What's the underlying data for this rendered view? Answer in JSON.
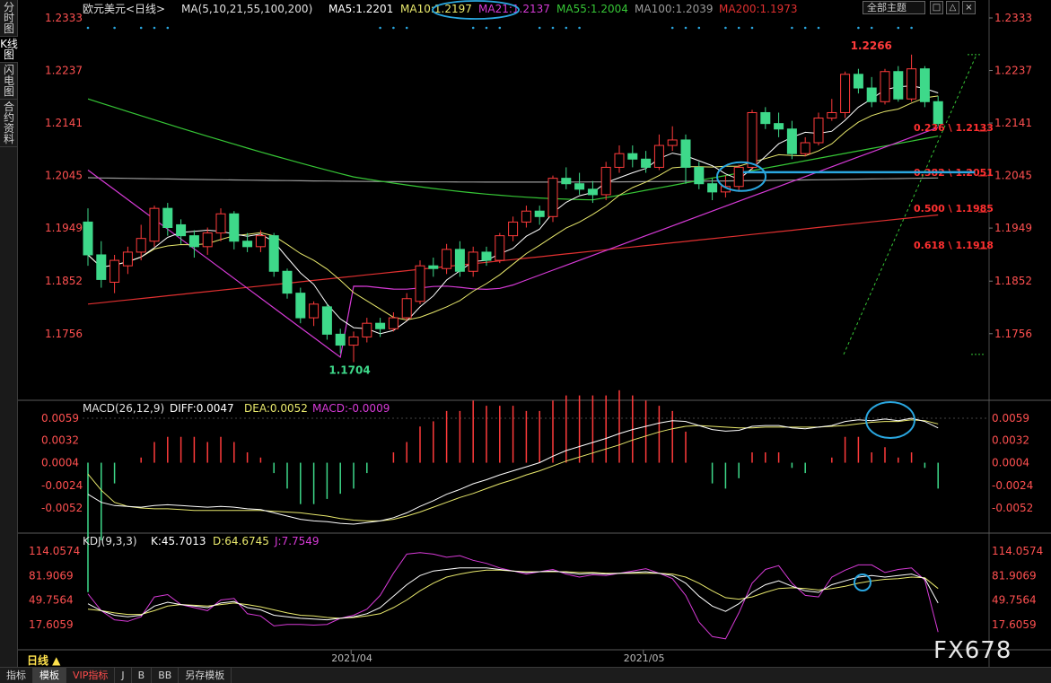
{
  "leftbar": {
    "tabs": [
      "分时图",
      "K线图",
      "闪电图",
      "合约资料"
    ],
    "active": 1
  },
  "toolbar": {
    "all_label": "全部主题",
    "buttons": [
      "□",
      "△",
      "×"
    ]
  },
  "bottombar": {
    "tabs": [
      "指标",
      "模板",
      "VIP指标",
      "J",
      "B",
      "BB",
      "另存模板"
    ],
    "active": 1,
    "vip_color": "#ff4c4c"
  },
  "period_label": "日线 ▲",
  "watermark": "FX678",
  "colors": {
    "up": "#ff3b3b",
    "down": "#3ed98a",
    "ma5": "#ffffff",
    "ma10": "#e8e86c",
    "ma21": "#d63ad6",
    "ma55": "#36c636",
    "ma100": "#9a9a9a",
    "ma200": "#e03030",
    "fib": "#ff3030",
    "annot": "#2aa7e0",
    "grid": "#303030",
    "axis_text": "#ff5050"
  },
  "chart_data": [
    {
      "type": "candlestick",
      "title": "欧元美元<日线>",
      "legend": [
        {
          "text": "MA(5,10,21,55,100,200)",
          "color": "#e0e0e0"
        },
        {
          "text": "MA5:1.2201",
          "color": "#ffffff"
        },
        {
          "text": "MA10:1.2197",
          "color": "#e8e86c"
        },
        {
          "text": "MA21:1.2137",
          "color": "#d63ad6"
        },
        {
          "text": "MA55:1.2004",
          "color": "#36c636"
        },
        {
          "text": "MA100:1.2039",
          "color": "#9a9a9a"
        },
        {
          "text": "MA200:1.1973",
          "color": "#e03030"
        }
      ],
      "y_ticks": [
        "1.2333",
        "1.2237",
        "1.2141",
        "1.2045",
        "1.1949",
        "1.1852",
        "1.1756"
      ],
      "ylim": [
        1.169,
        1.2333
      ],
      "x_ticks": [
        {
          "label": "2021/04",
          "index": 19
        },
        {
          "label": "2021/05",
          "index": 41
        }
      ],
      "annotations": [
        {
          "text": "1.2266",
          "index": 57,
          "value": 1.2266,
          "color": "#ff3b3b"
        },
        {
          "text": "1.1704",
          "index": 18,
          "value": 1.1704,
          "color": "#3ed98a"
        }
      ],
      "fib_levels": [
        {
          "text": "0.236 \\ 1.2133",
          "value": 1.2133
        },
        {
          "text": "0.382 \\ 1.2051",
          "value": 1.2051
        },
        {
          "text": "0.500 \\ 1.1985",
          "value": 1.1985
        },
        {
          "text": "0.618 \\ 1.1918",
          "value": 1.1918
        }
      ],
      "candles": [
        [
          1.196,
          1.19,
          1.1985,
          1.188
        ],
        [
          1.19,
          1.1855,
          1.1925,
          1.184
        ],
        [
          1.185,
          1.189,
          1.19,
          1.183
        ],
        [
          1.188,
          1.1905,
          1.1915,
          1.1865
        ],
        [
          1.1905,
          1.193,
          1.1955,
          1.189
        ],
        [
          1.1925,
          1.1985,
          1.199,
          1.1915
        ],
        [
          1.1985,
          1.195,
          1.1995,
          1.1935
        ],
        [
          1.1955,
          1.1935,
          1.1965,
          1.192
        ],
        [
          1.1935,
          1.1915,
          1.1945,
          1.1895
        ],
        [
          1.1915,
          1.194,
          1.195,
          1.19
        ],
        [
          1.194,
          1.1975,
          1.1985,
          1.1925
        ],
        [
          1.1975,
          1.1925,
          1.198,
          1.191
        ],
        [
          1.1925,
          1.1915,
          1.194,
          1.1905
        ],
        [
          1.1915,
          1.1935,
          1.1945,
          1.1905
        ],
        [
          1.1935,
          1.187,
          1.194,
          1.186
        ],
        [
          1.187,
          1.183,
          1.1875,
          1.182
        ],
        [
          1.183,
          1.1785,
          1.184,
          1.1775
        ],
        [
          1.1785,
          1.181,
          1.1815,
          1.177
        ],
        [
          1.1805,
          1.1755,
          1.181,
          1.1745
        ],
        [
          1.1755,
          1.1735,
          1.1765,
          1.172
        ],
        [
          1.1735,
          1.175,
          1.176,
          1.1704
        ],
        [
          1.175,
          1.1775,
          1.1785,
          1.174
        ],
        [
          1.1775,
          1.1765,
          1.1785,
          1.175
        ],
        [
          1.1765,
          1.1785,
          1.1795,
          1.176
        ],
        [
          1.1785,
          1.182,
          1.183,
          1.178
        ],
        [
          1.1815,
          1.188,
          1.189,
          1.181
        ],
        [
          1.188,
          1.1875,
          1.1895,
          1.186
        ],
        [
          1.1875,
          1.191,
          1.192,
          1.1865
        ],
        [
          1.191,
          1.187,
          1.1925,
          1.186
        ],
        [
          1.187,
          1.1905,
          1.1915,
          1.186
        ],
        [
          1.1905,
          1.189,
          1.1915,
          1.188
        ],
        [
          1.189,
          1.1935,
          1.194,
          1.1885
        ],
        [
          1.1935,
          1.196,
          1.197,
          1.1925
        ],
        [
          1.196,
          1.198,
          1.199,
          1.195
        ],
        [
          1.198,
          1.197,
          1.199,
          1.1955
        ],
        [
          1.197,
          1.204,
          1.2045,
          1.196
        ],
        [
          1.204,
          1.203,
          1.206,
          1.202
        ],
        [
          1.203,
          1.202,
          1.205,
          1.201
        ],
        [
          1.202,
          1.201,
          1.2035,
          1.1995
        ],
        [
          1.201,
          1.206,
          1.207,
          1.2
        ],
        [
          1.206,
          1.2085,
          1.21,
          1.205
        ],
        [
          1.2085,
          1.2075,
          1.21,
          1.206
        ],
        [
          1.2075,
          1.206,
          1.209,
          1.205
        ],
        [
          1.206,
          1.21,
          1.212,
          1.2055
        ],
        [
          1.21,
          1.211,
          1.2135,
          1.209
        ],
        [
          1.211,
          1.206,
          1.212,
          1.203
        ],
        [
          1.206,
          1.203,
          1.207,
          1.202
        ],
        [
          1.203,
          1.2015,
          1.204,
          1.2
        ],
        [
          1.2015,
          1.2025,
          1.2045,
          1.2005
        ],
        [
          1.2025,
          1.206,
          1.2065,
          1.2015
        ],
        [
          1.206,
          1.216,
          1.2165,
          1.2055
        ],
        [
          1.216,
          1.214,
          1.217,
          1.213
        ],
        [
          1.214,
          1.213,
          1.216,
          1.2115
        ],
        [
          1.213,
          1.2085,
          1.2145,
          1.2075
        ],
        [
          1.2085,
          1.2105,
          1.2115,
          1.208
        ],
        [
          1.2105,
          1.215,
          1.216,
          1.21
        ],
        [
          1.215,
          1.216,
          1.2185,
          1.2145
        ],
        [
          1.216,
          1.223,
          1.2235,
          1.215
        ],
        [
          1.223,
          1.2205,
          1.224,
          1.2195
        ],
        [
          1.2205,
          1.218,
          1.2225,
          1.217
        ],
        [
          1.218,
          1.2235,
          1.224,
          1.2175
        ],
        [
          1.2235,
          1.2185,
          1.2245,
          1.218
        ],
        [
          1.2185,
          1.224,
          1.2266,
          1.218
        ],
        [
          1.224,
          1.218,
          1.2245,
          1.217
        ],
        [
          1.218,
          1.214,
          1.219,
          1.2135
        ]
      ]
    },
    {
      "type": "line",
      "title": "MACD(26,12,9)",
      "legend": [
        {
          "text": "MACD(26,12,9)",
          "color": "#e0e0e0"
        },
        {
          "text": "DIFF:0.0047",
          "color": "#ffffff"
        },
        {
          "text": "DEA:0.0052",
          "color": "#e8e86c"
        },
        {
          "text": "MACD:-0.0009",
          "color": "#d63ad6"
        }
      ],
      "y_ticks": [
        "0.0059",
        "0.0032",
        "0.0004",
        "-0.0024",
        "-0.0052"
      ],
      "ylim": [
        -0.0075,
        0.0078
      ],
      "diff": [
        -0.0035,
        -0.0045,
        -0.0049,
        -0.005,
        -0.0051,
        -0.0049,
        -0.0048,
        -0.0049,
        -0.005,
        -0.0051,
        -0.005,
        -0.0051,
        -0.0053,
        -0.0054,
        -0.0058,
        -0.0062,
        -0.0066,
        -0.0068,
        -0.0069,
        -0.0071,
        -0.0072,
        -0.007,
        -0.0068,
        -0.0064,
        -0.0058,
        -0.005,
        -0.0043,
        -0.0035,
        -0.0029,
        -0.0022,
        -0.0017,
        -0.0011,
        -0.0006,
        -0.0001,
        0.0004,
        0.0012,
        0.0019,
        0.0024,
        0.0029,
        0.0034,
        0.004,
        0.0045,
        0.0049,
        0.0053,
        0.0056,
        0.0055,
        0.005,
        0.0045,
        0.0043,
        0.0044,
        0.0049,
        0.005,
        0.005,
        0.0047,
        0.0046,
        0.0048,
        0.005,
        0.0055,
        0.0057,
        0.0056,
        0.0058,
        0.0056,
        0.0059,
        0.0055,
        0.0047
      ],
      "dea": [
        -0.001,
        -0.003,
        -0.0045,
        -0.005,
        -0.0052,
        -0.0053,
        -0.0053,
        -0.0054,
        -0.0055,
        -0.0055,
        -0.0055,
        -0.0055,
        -0.0055,
        -0.0055,
        -0.0056,
        -0.0057,
        -0.0058,
        -0.006,
        -0.0062,
        -0.0065,
        -0.0067,
        -0.0068,
        -0.0068,
        -0.0066,
        -0.0062,
        -0.0057,
        -0.0051,
        -0.0045,
        -0.0039,
        -0.0034,
        -0.0028,
        -0.0022,
        -0.0017,
        -0.0011,
        -0.0006,
        0.0,
        0.0006,
        0.0011,
        0.0016,
        0.0021,
        0.0026,
        0.0032,
        0.0037,
        0.0042,
        0.0046,
        0.0049,
        0.005,
        0.0049,
        0.0048,
        0.0047,
        0.0047,
        0.0048,
        0.0048,
        0.0048,
        0.0048,
        0.0048,
        0.0049,
        0.005,
        0.0052,
        0.0054,
        0.0055,
        0.0055,
        0.0057,
        0.0056,
        0.0052
      ]
    },
    {
      "type": "line",
      "title": "KDJ(9,3,3)",
      "legend": [
        {
          "text": "KDJ(9,3,3)",
          "color": "#e0e0e0"
        },
        {
          "text": "K:45.7013",
          "color": "#ffffff"
        },
        {
          "text": "D:64.6745",
          "color": "#e8e86c"
        },
        {
          "text": "J:7.7549",
          "color": "#d63ad6"
        }
      ],
      "y_ticks": [
        "114.0574",
        "81.9069",
        "49.7564",
        "17.6059"
      ],
      "ylim": [
        -5,
        125
      ],
      "k": [
        45,
        36,
        30,
        28,
        30,
        42,
        47,
        44,
        42,
        40,
        46,
        48,
        40,
        37,
        30,
        28,
        26,
        25,
        24,
        26,
        28,
        32,
        40,
        55,
        70,
        82,
        88,
        90,
        92,
        92,
        92,
        90,
        88,
        86,
        87,
        88,
        86,
        84,
        85,
        84,
        85,
        86,
        87,
        85,
        82,
        72,
        55,
        42,
        35,
        45,
        60,
        70,
        75,
        68,
        62,
        60,
        70,
        75,
        80,
        82,
        80,
        82,
        84,
        78,
        46
      ],
      "d": [
        38,
        36,
        33,
        31,
        31,
        36,
        42,
        44,
        43,
        42,
        44,
        46,
        44,
        41,
        37,
        33,
        30,
        29,
        27,
        26,
        27,
        29,
        32,
        40,
        50,
        62,
        72,
        80,
        84,
        87,
        89,
        89,
        88,
        87,
        87,
        87,
        87,
        86,
        86,
        85,
        85,
        85,
        85,
        85,
        84,
        80,
        72,
        62,
        53,
        51,
        54,
        60,
        65,
        66,
        65,
        63,
        65,
        68,
        72,
        75,
        77,
        78,
        80,
        79,
        65
      ],
      "j": [
        58,
        36,
        24,
        22,
        28,
        54,
        57,
        44,
        40,
        36,
        50,
        52,
        32,
        29,
        16,
        18,
        18,
        17,
        18,
        26,
        30,
        38,
        56,
        85,
        110,
        112,
        110,
        106,
        108,
        102,
        98,
        92,
        88,
        84,
        87,
        90,
        84,
        80,
        83,
        82,
        85,
        88,
        91,
        85,
        78,
        56,
        21,
        2,
        -1,
        33,
        72,
        90,
        95,
        72,
        56,
        54,
        80,
        89,
        96,
        96,
        86,
        90,
        92,
        76,
        8
      ]
    }
  ]
}
